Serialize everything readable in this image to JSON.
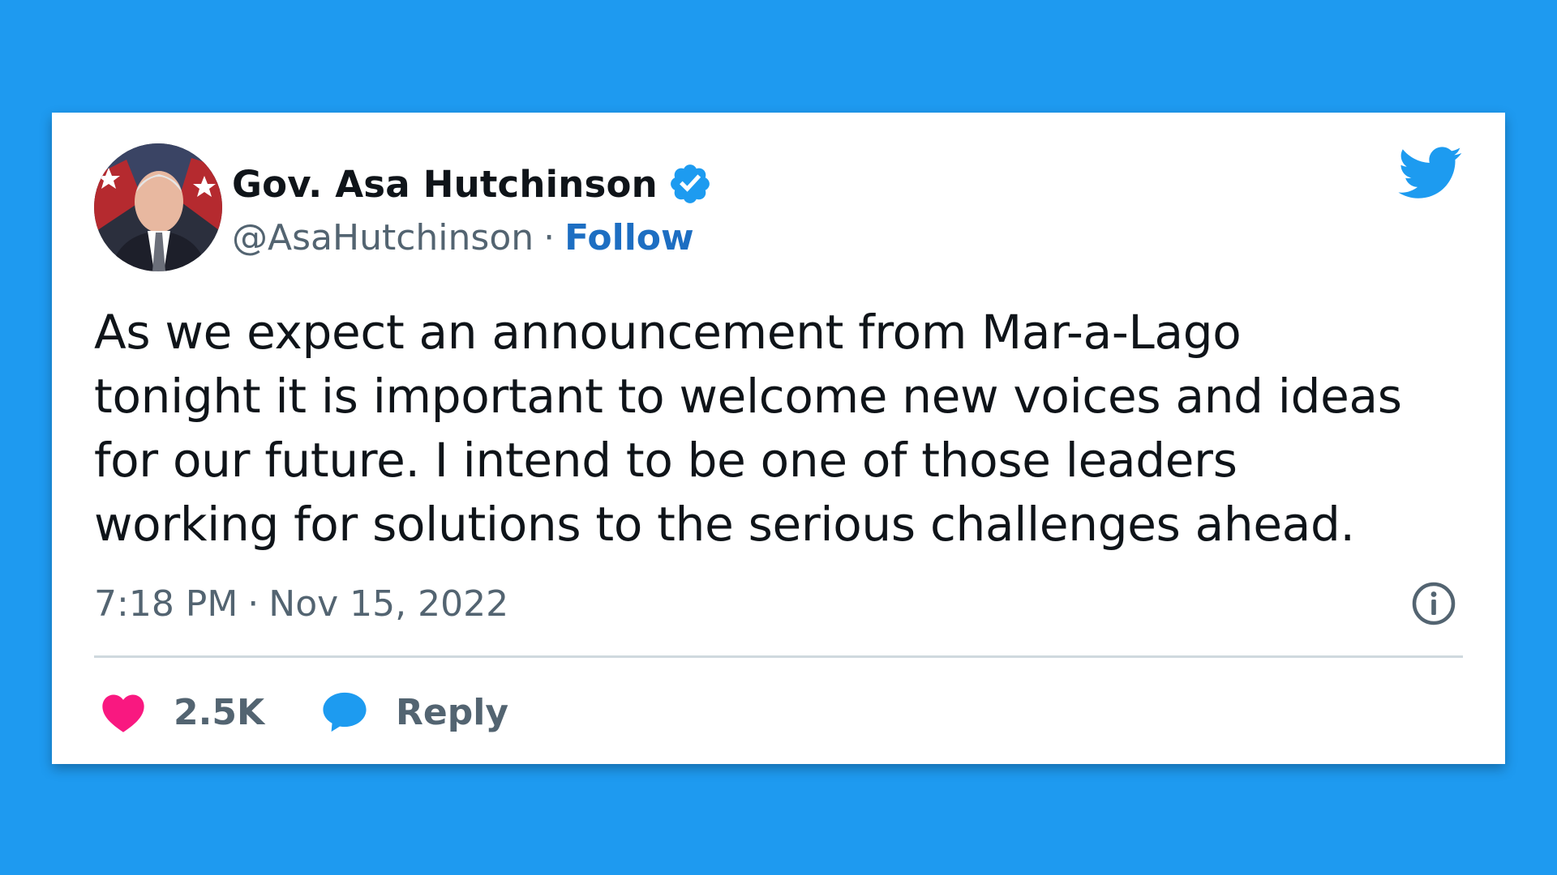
{
  "tweet": {
    "author": {
      "display_name": "Gov. Asa Hutchinson",
      "handle": "@AsaHutchinson",
      "separator": "·",
      "follow_label": "Follow",
      "verified": true
    },
    "text": "As we expect an announcement from Mar-a-Lago\ntonight it is important to welcome new voices and ideas\nfor our future.  I intend to be one of those leaders\nworking for solutions to the serious challenges ahead.",
    "time": "7:18 PM",
    "date_separator": "·",
    "date": "Nov 15, 2022",
    "like_count": "2.5K",
    "reply_label": "Reply"
  },
  "icons": {
    "brand": "twitter-bird-icon",
    "verified": "verified-badge-icon",
    "info": "info-icon",
    "like": "heart-icon",
    "reply": "reply-bubble-icon"
  },
  "colors": {
    "background": "#1e9af0",
    "card": "#ffffff",
    "text": "#0f1419",
    "secondary": "#536471",
    "link": "#1d6ec2",
    "brand": "#1d9bf0",
    "like": "#f91880"
  }
}
